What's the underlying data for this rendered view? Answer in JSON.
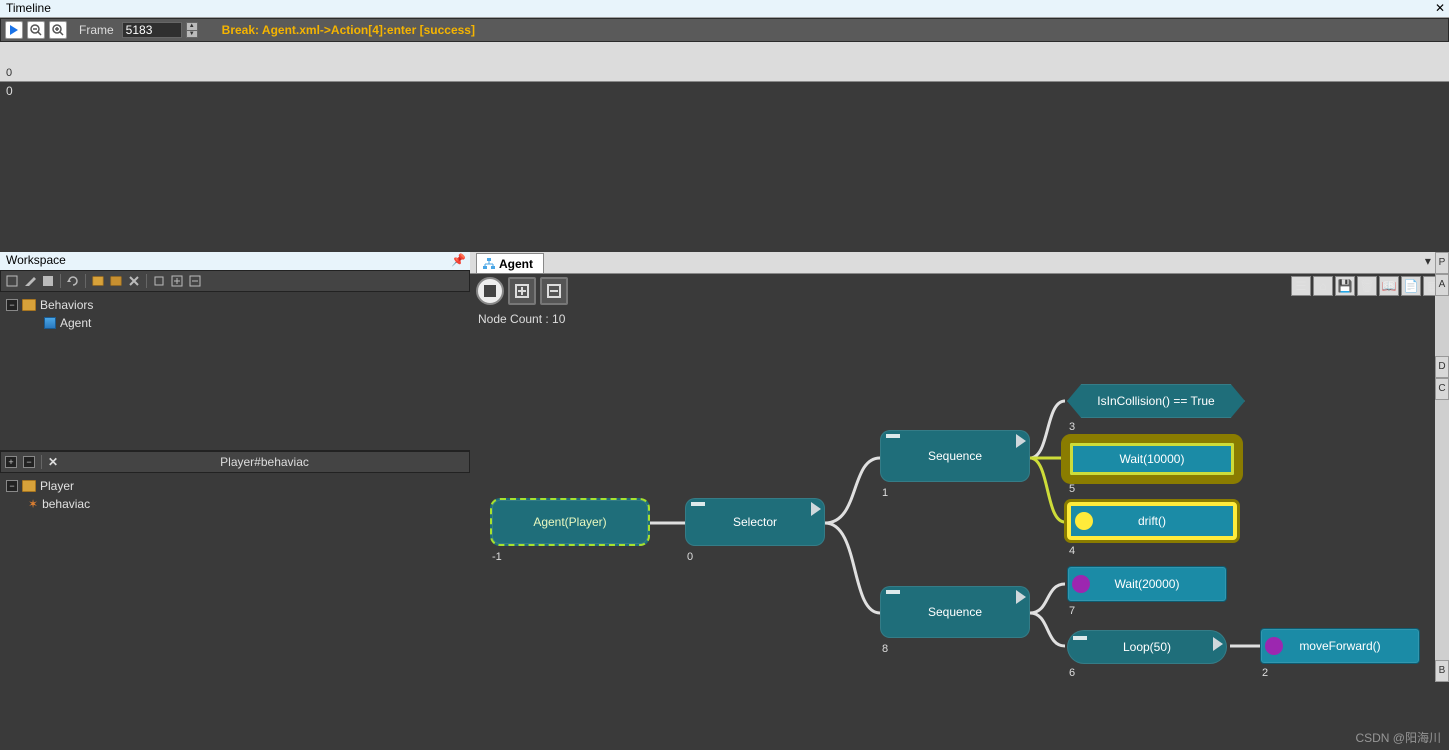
{
  "timeline": {
    "title": "Timeline",
    "frame_label": "Frame",
    "frame_value": "5183",
    "break_text": "Break: Agent.xml->Action[4]:enter [success]",
    "track_start": "0",
    "axis_zero": "0"
  },
  "workspace": {
    "title": "Workspace",
    "tree": {
      "root": "Behaviors",
      "child": "Agent"
    }
  },
  "player": {
    "label": "Player#behaviac",
    "tree": {
      "root": "Player",
      "child": "behaviac"
    }
  },
  "canvas": {
    "tab": "Agent",
    "node_count": "Node Count : 10",
    "nodes": {
      "root": {
        "label": "Agent(Player)",
        "idx": "-1"
      },
      "selector": {
        "label": "Selector",
        "idx": "0"
      },
      "seq1": {
        "label": "Sequence",
        "idx": "1"
      },
      "seq8": {
        "label": "Sequence",
        "idx": "8"
      },
      "cond": {
        "label": "IsInCollision()  ==  True",
        "idx": "3"
      },
      "wait10": {
        "label": "Wait(10000)",
        "idx": "5"
      },
      "drift": {
        "label": "drift()",
        "idx": "4"
      },
      "wait20": {
        "label": "Wait(20000)",
        "idx": "7"
      },
      "loop": {
        "label": "Loop(50)",
        "idx": "6"
      },
      "move": {
        "label": "moveForward()",
        "idx": "2"
      }
    }
  },
  "dock": {
    "items": [
      "P",
      "A",
      "D",
      "C",
      "B"
    ]
  },
  "watermark": "CSDN @阳海川"
}
